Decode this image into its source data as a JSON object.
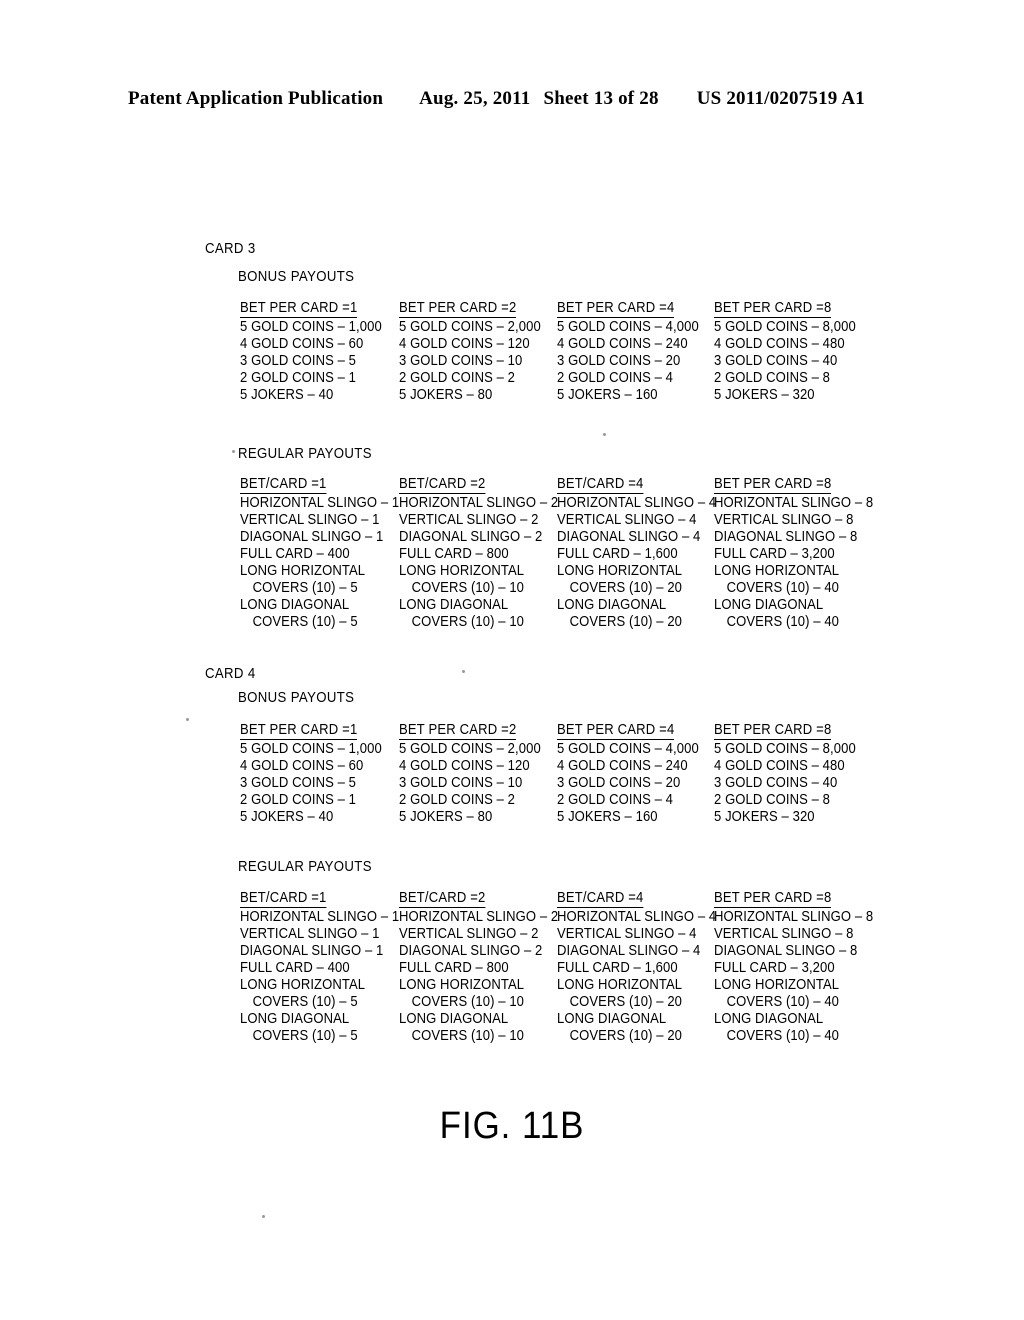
{
  "header": {
    "publication": "Patent Application Publication",
    "date": "Aug. 25, 2011",
    "sheet": "Sheet 13 of 28",
    "number": "US 2011/0207519 A1"
  },
  "figure": {
    "caption": "FIG. 11B",
    "cards": [
      {
        "title": "CARD 3",
        "sections": [
          {
            "name": "BONUS PAYOUTS",
            "columns": [
              {
                "header": "BET PER CARD =1",
                "rows": [
                  "5 GOLD COINS – 1,000",
                  "4 GOLD COINS – 60",
                  "3 GOLD COINS – 5",
                  "2 GOLD COINS – 1",
                  "5 JOKERS – 40"
                ]
              },
              {
                "header": "BET PER CARD =2",
                "rows": [
                  "5 GOLD COINS – 2,000",
                  "4 GOLD COINS – 120",
                  "3 GOLD COINS – 10",
                  "2 GOLD COINS – 2",
                  "5 JOKERS – 80"
                ]
              },
              {
                "header": "BET PER CARD =4",
                "rows": [
                  "5 GOLD COINS – 4,000",
                  "4 GOLD COINS – 240",
                  "3 GOLD COINS – 20",
                  "2 GOLD COINS – 4",
                  "5 JOKERS – 160"
                ]
              },
              {
                "header": "BET PER CARD =8",
                "rows": [
                  "5 GOLD COINS – 8,000",
                  "4 GOLD COINS – 480",
                  "3 GOLD COINS – 40",
                  "2 GOLD COINS – 8",
                  "5 JOKERS – 320"
                ]
              }
            ]
          },
          {
            "name": "REGULAR PAYOUTS",
            "columns": [
              {
                "header": "BET/CARD =1",
                "rows": [
                  "HORIZONTAL SLINGO – 1",
                  "VERTICAL SLINGO – 1",
                  "DIAGONAL SLINGO – 1",
                  "FULL CARD – 400",
                  "LONG HORIZONTAL",
                  "COVERS (10) – 5",
                  "LONG DIAGONAL",
                  "COVERS (10) – 5"
                ],
                "indents": [
                  false,
                  false,
                  false,
                  false,
                  false,
                  true,
                  false,
                  true
                ]
              },
              {
                "header": "BET/CARD =2",
                "rows": [
                  "HORIZONTAL SLINGO – 2",
                  "VERTICAL SLINGO – 2",
                  "DIAGONAL SLINGO – 2",
                  "FULL CARD – 800",
                  "LONG HORIZONTAL",
                  "COVERS (10) – 10",
                  "LONG DIAGONAL",
                  "COVERS (10) – 10"
                ],
                "indents": [
                  false,
                  false,
                  false,
                  false,
                  false,
                  true,
                  false,
                  true
                ]
              },
              {
                "header": "BET/CARD =4",
                "rows": [
                  "HORIZONTAL SLINGO – 4",
                  "VERTICAL SLINGO – 4",
                  "DIAGONAL SLINGO – 4",
                  "FULL CARD – 1,600",
                  "LONG HORIZONTAL",
                  "COVERS (10) – 20",
                  "LONG DIAGONAL",
                  "COVERS (10) – 20"
                ],
                "indents": [
                  false,
                  false,
                  false,
                  false,
                  false,
                  true,
                  false,
                  true
                ]
              },
              {
                "header": "BET PER CARD =8",
                "rows": [
                  "HORIZONTAL SLINGO – 8",
                  "VERTICAL SLINGO – 8",
                  "DIAGONAL SLINGO – 8",
                  "FULL CARD – 3,200",
                  "LONG HORIZONTAL",
                  "COVERS (10) – 40",
                  "LONG DIAGONAL",
                  "COVERS (10) – 40"
                ],
                "indents": [
                  false,
                  false,
                  false,
                  false,
                  false,
                  true,
                  false,
                  true
                ]
              }
            ]
          }
        ]
      },
      {
        "title": "CARD 4",
        "sections": [
          {
            "name": "BONUS PAYOUTS",
            "columns": [
              {
                "header": "BET PER CARD =1",
                "rows": [
                  "5 GOLD COINS – 1,000",
                  "4 GOLD COINS – 60",
                  "3 GOLD COINS – 5",
                  "2 GOLD COINS – 1",
                  "5 JOKERS – 40"
                ]
              },
              {
                "header": "BET PER CARD =2",
                "rows": [
                  "5 GOLD COINS – 2,000",
                  "4 GOLD COINS – 120",
                  "3 GOLD COINS – 10",
                  "2 GOLD COINS – 2",
                  "5 JOKERS – 80"
                ]
              },
              {
                "header": "BET PER CARD =4",
                "rows": [
                  "5 GOLD COINS – 4,000",
                  "4 GOLD COINS – 240",
                  "3 GOLD COINS – 20",
                  "2 GOLD COINS – 4",
                  "5 JOKERS – 160"
                ]
              },
              {
                "header": "BET PER CARD =8",
                "rows": [
                  "5 GOLD COINS – 8,000",
                  "4 GOLD COINS – 480",
                  "3 GOLD COINS – 40",
                  "2 GOLD COINS – 8",
                  "5 JOKERS – 320"
                ]
              }
            ]
          },
          {
            "name": "REGULAR PAYOUTS",
            "columns": [
              {
                "header": "BET/CARD =1",
                "rows": [
                  "HORIZONTAL SLINGO – 1",
                  "VERTICAL SLINGO – 1",
                  "DIAGONAL SLINGO – 1",
                  "FULL CARD – 400",
                  "LONG HORIZONTAL",
                  "COVERS (10) – 5",
                  "LONG DIAGONAL",
                  "COVERS (10) – 5"
                ],
                "indents": [
                  false,
                  false,
                  false,
                  false,
                  false,
                  true,
                  false,
                  true
                ]
              },
              {
                "header": "BET/CARD =2",
                "rows": [
                  "HORIZONTAL SLINGO – 2",
                  "VERTICAL SLINGO – 2",
                  "DIAGONAL SLINGO – 2",
                  "FULL CARD – 800",
                  "LONG HORIZONTAL",
                  "COVERS (10) – 10",
                  "LONG DIAGONAL",
                  "COVERS (10) – 10"
                ],
                "indents": [
                  false,
                  false,
                  false,
                  false,
                  false,
                  true,
                  false,
                  true
                ]
              },
              {
                "header": "BET/CARD =4",
                "rows": [
                  "HORIZONTAL SLINGO – 4",
                  "VERTICAL SLINGO – 4",
                  "DIAGONAL SLINGO – 4",
                  "FULL CARD – 1,600",
                  "LONG HORIZONTAL",
                  "COVERS (10) – 20",
                  "LONG DIAGONAL",
                  "COVERS (10) – 20"
                ],
                "indents": [
                  false,
                  false,
                  false,
                  false,
                  false,
                  true,
                  false,
                  true
                ]
              },
              {
                "header": "BET PER CARD =8",
                "rows": [
                  "HORIZONTAL SLINGO – 8",
                  "VERTICAL SLINGO – 8",
                  "DIAGONAL SLINGO – 8",
                  "FULL CARD – 3,200",
                  "LONG HORIZONTAL",
                  "COVERS (10) – 40",
                  "LONG DIAGONAL",
                  "COVERS (10) – 40"
                ],
                "indents": [
                  false,
                  false,
                  false,
                  false,
                  false,
                  true,
                  false,
                  true
                ]
              }
            ]
          }
        ]
      }
    ]
  }
}
